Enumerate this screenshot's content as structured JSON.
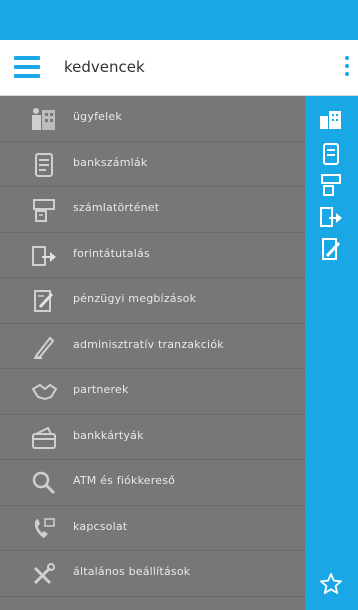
{
  "appbar": {
    "title": "kedvencek"
  },
  "menu": {
    "items": [
      {
        "label": "ügyfelek",
        "icon": "building-icon"
      },
      {
        "label": "bankszámlák",
        "icon": "document-icon"
      },
      {
        "label": "számlatörténet",
        "icon": "statement-history-icon"
      },
      {
        "label": "forintátutalás",
        "icon": "transfer-icon"
      },
      {
        "label": "pénzügyi megbízások",
        "icon": "financial-order-icon"
      },
      {
        "label": "adminisztratív tranzakciók",
        "icon": "admin-pen-icon"
      },
      {
        "label": "partnerek",
        "icon": "handshake-icon"
      },
      {
        "label": "bankkártyák",
        "icon": "card-wallet-icon"
      },
      {
        "label": "ATM és fiókkereső",
        "icon": "magnifier-icon"
      },
      {
        "label": "kapcsolat",
        "icon": "phone-icon"
      },
      {
        "label": "általános beállítások",
        "icon": "settings-tools-icon"
      }
    ]
  },
  "rail": {
    "icons": [
      "building-icon",
      "document-icon",
      "statement-history-icon",
      "transfer-icon",
      "financial-order-icon",
      "star-icon"
    ]
  },
  "colors": {
    "primary": "#1aa7e6",
    "drawer_bg": "#777777",
    "drawer_text": "#e9e9e9",
    "icon_color": "#d8d8d8"
  }
}
